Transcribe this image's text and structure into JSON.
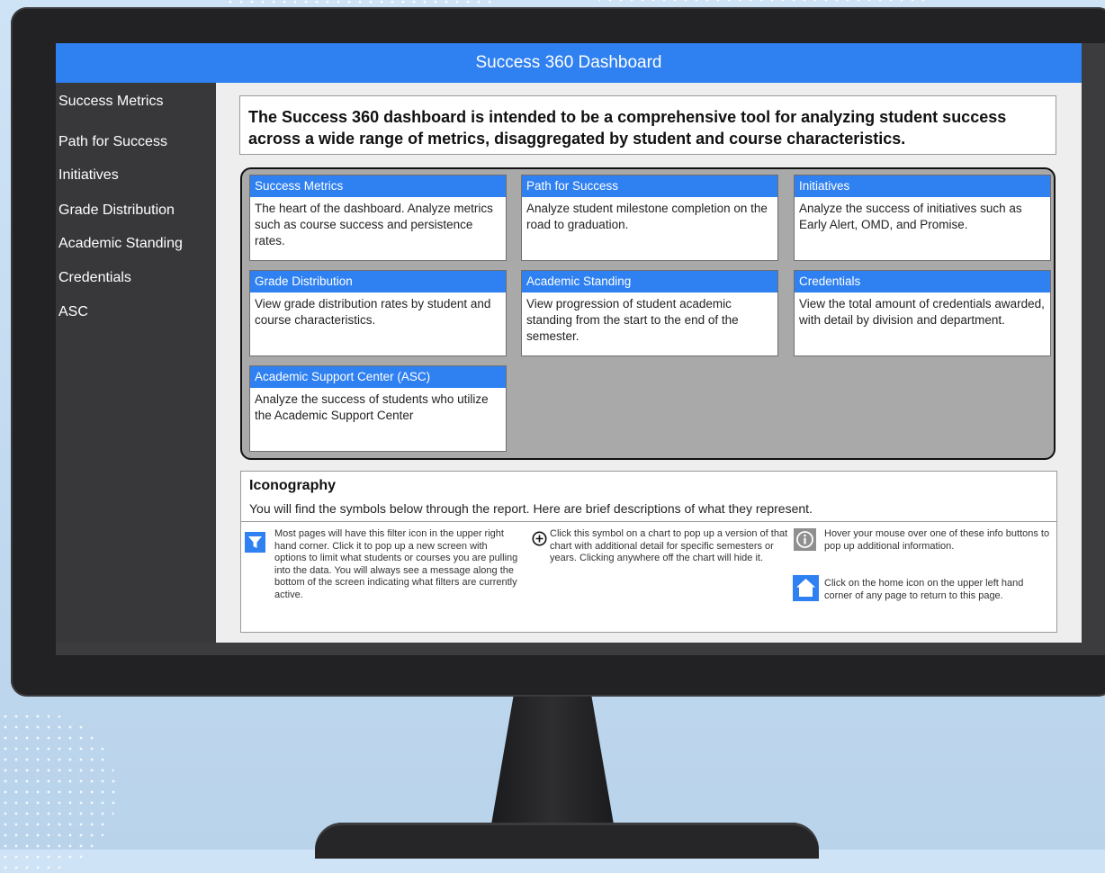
{
  "header": {
    "title": "Success 360 Dashboard"
  },
  "sidebar": {
    "items": [
      {
        "label": "Success Metrics"
      },
      {
        "label": "Path for Success"
      },
      {
        "label": "Initiatives"
      },
      {
        "label": "Grade Distribution"
      },
      {
        "label": "Academic Standing"
      },
      {
        "label": "Credentials"
      },
      {
        "label": "ASC"
      }
    ]
  },
  "intro": {
    "text": "The Success 360 dashboard is intended to be a comprehensive tool for analyzing student success across a wide range of metrics, disaggregated by student and course characteristics."
  },
  "tiles": [
    {
      "title": "Success Metrics",
      "description": "The heart of the dashboard.  Analyze metrics such as course success and persistence rates."
    },
    {
      "title": "Path for Success",
      "description": "Analyze student milestone completion on the road to graduation."
    },
    {
      "title": "Initiatives",
      "description": "Analyze the success of initiatives such as Early Alert, OMD, and Promise."
    },
    {
      "title": "Grade Distribution",
      "description": "View grade distribution rates by student and course characteristics."
    },
    {
      "title": "Academic Standing",
      "description": "View progression of student academic standing from the start to the end of the semester."
    },
    {
      "title": "Credentials",
      "description": "View the total amount of credentials awarded, with detail by division and department."
    },
    {
      "title": "Academic Support Center (ASC)",
      "description": "Analyze the success of students who utilize the Academic Support Center"
    }
  ],
  "iconography": {
    "heading": "Iconography",
    "subtitle": "You will find the symbols below through the report.  Here are brief descriptions of what they represent.",
    "filter_text": "Most pages will have this filter icon in the upper right hand corner.  Click it to pop up a new screen with options to limit what students or courses you are pulling into the data.  You will always see a message along the bottom of the screen indicating what filters are currently active.",
    "plus_text": "Click this symbol on a chart to pop up a version of that chart with additional detail for specific semesters or years.  Clicking anywhere off the chart will hide it.",
    "info_text": "Hover your mouse over one of these info buttons to pop up additional information.",
    "home_text": "Click on the home icon on the upper left hand corner of any page to return to this page."
  },
  "icons": {
    "filter": "filter-icon",
    "plus": "plus-circle-icon",
    "info": "info-icon",
    "home": "home-icon"
  },
  "colors": {
    "accent": "#2f80f0",
    "sidebar": "#38383b",
    "tile_container": "#a9a9a9"
  }
}
